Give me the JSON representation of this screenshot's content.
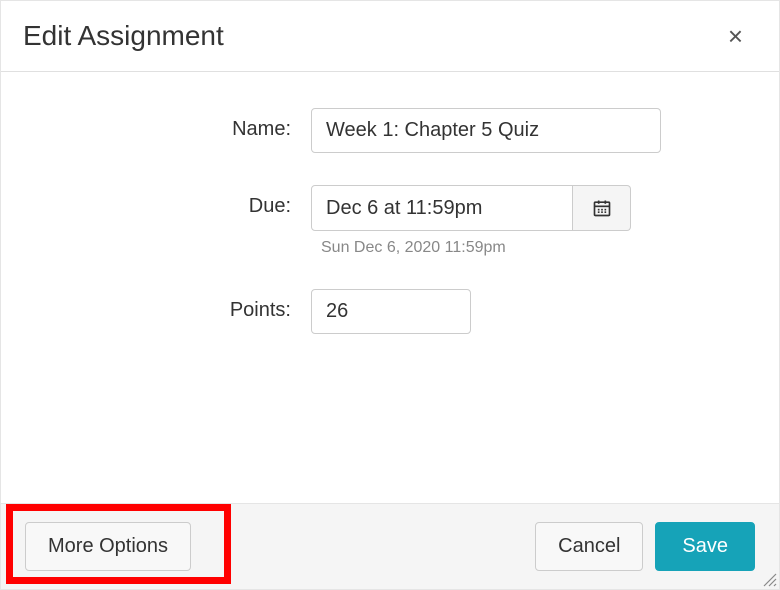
{
  "header": {
    "title": "Edit Assignment"
  },
  "form": {
    "name_label": "Name:",
    "name_value": "Week 1: Chapter 5 Quiz",
    "due_label": "Due:",
    "due_value": "Dec 6 at 11:59pm",
    "due_helper": "Sun Dec 6, 2020 11:59pm",
    "points_label": "Points:",
    "points_value": "26"
  },
  "footer": {
    "more_options": "More Options",
    "cancel": "Cancel",
    "save": "Save"
  }
}
